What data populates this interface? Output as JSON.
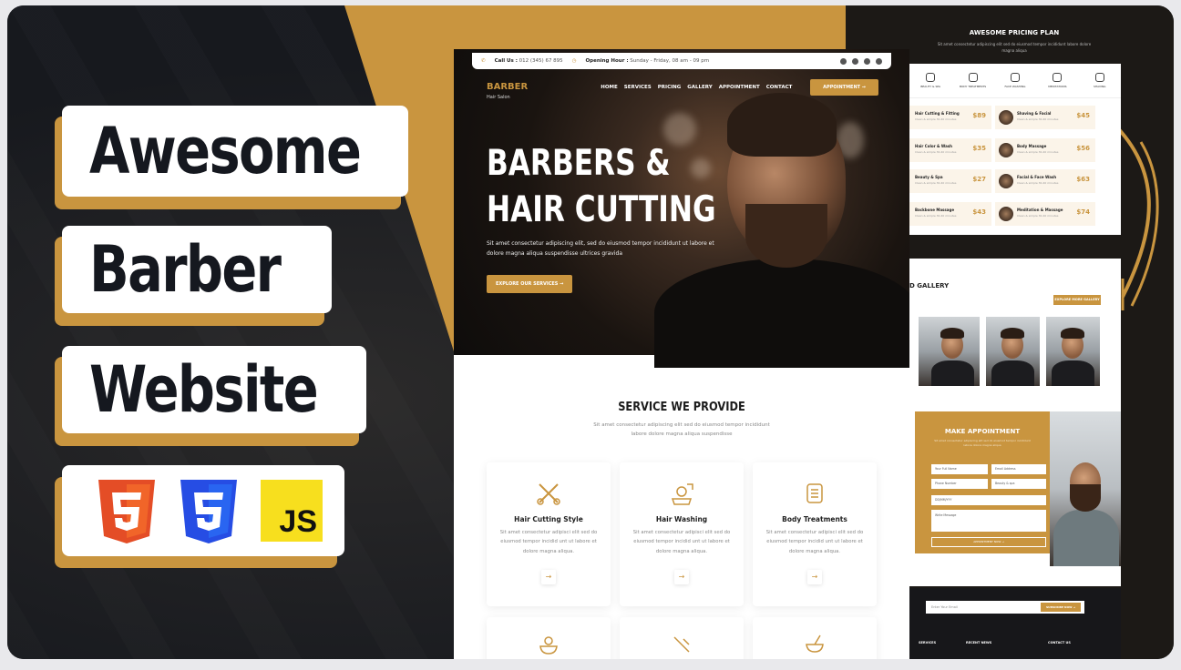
{
  "thumbnail": {
    "title_lines": [
      "Awesome",
      "Barber",
      "Website"
    ],
    "tech_icons": [
      "html5-icon",
      "css3-icon",
      "javascript-icon"
    ],
    "js_label": "JS",
    "colors": {
      "gold": "#c9953f",
      "dark": "#16181d",
      "html": "#e44d26",
      "css": "#264de4",
      "js": "#f7df1e"
    }
  },
  "site": {
    "topbar": {
      "call_label": "Call Us :",
      "call_value": "012 (345) 67 895",
      "hours_label": "Opening Hour :",
      "hours_value": "Sunday - Friday, 08 am - 09 pm"
    },
    "logo": {
      "name": "BARBER",
      "sub": "Hair Salon"
    },
    "menu": [
      "HOME",
      "SERVICES",
      "PRICING",
      "GALLERY",
      "APPOINTMENT",
      "CONTACT"
    ],
    "appointment_button": "APPOINTMENT →",
    "hero": {
      "title_line1": "BARBERS &",
      "title_line2": "HAIR CUTTING",
      "text": "Sit amet consectetur adipiscing elit, sed do eiusmod tempor incididunt ut labore et dolore magna aliqua suspendisse ultrices gravida",
      "button": "EXPLORE OUR SERVICES →"
    },
    "services": {
      "title": "SERVICE WE PROVIDE",
      "subtitle": "Sit amet consectetur adipiscing elit sed do eiusmod tempor incididunt labore dolore magna aliqua suspendisse",
      "cards": [
        {
          "title": "Hair Cutting Style",
          "text": "Sit amet consectetur adipisci elit sed do eiusmod tempor incidid unt ut labore et dolore magna aliqua.",
          "arrow": "→"
        },
        {
          "title": "Hair Washing",
          "text": "Sit amet consectetur adipisci elit sed do eiusmod tempor incidid unt ut labore et dolore magna aliqua.",
          "arrow": "→"
        },
        {
          "title": "Body Treatments",
          "text": "Sit amet consectetur adipisci elit sed do eiusmod tempor incidid unt ut labore et dolore magna aliqua.",
          "arrow": "→"
        }
      ]
    }
  },
  "right_panel": {
    "pricing_title": "AWESOME PRICING PLAN",
    "pricing_sub": "Sit amet consectetur adipiscing elit sed do eiusmod tempor incididunt labore dolore magna aliqua",
    "tabs": [
      "BEAUTY & SPA",
      "BODY TREATMENTS",
      "FACE WASHING",
      "MEDITATIONS",
      "SHAVING"
    ],
    "left_prices": [
      {
        "name": "Hair Cutting & Fitting",
        "desc": "Clean & simple 30-40 minutes",
        "price": "$89"
      },
      {
        "name": "Hair Color & Wash",
        "desc": "Clean & simple 30-40 minutes",
        "price": "$35"
      },
      {
        "name": "Beauty & Spa",
        "desc": "Clean & simple 30-40 minutes",
        "price": "$27"
      },
      {
        "name": "Backbone Massage",
        "desc": "Clean & simple 30-40 minutes",
        "price": "$43"
      }
    ],
    "right_prices": [
      {
        "name": "Shaving & Facial",
        "desc": "Clean & simple 30-40 minutes",
        "price": "$45"
      },
      {
        "name": "Body Massage",
        "desc": "Clean & simple 30-40 minutes",
        "price": "$56"
      },
      {
        "name": "Facial & Face Wash",
        "desc": "Clean & simple 30-40 minutes",
        "price": "$63"
      },
      {
        "name": "Meditation & Massage",
        "desc": "Clean & simple 30-40 minutes",
        "price": "$74"
      }
    ],
    "gallery_title": "D GALLERY",
    "gallery_button": "EXPLORE MORE GALLERY →",
    "appointment": {
      "title": "MAKE APPOINTMENT",
      "sub": "Sit amet consectetur adipiscing elit sed do eiusmod tempor incididunt labore dolore magna aliqua",
      "fields": [
        "Your Full Name",
        "Email Address",
        "Phone Number",
        "Beauty & spa",
        "DD/MM/YYY",
        "Write Message"
      ],
      "button": "APPOINTMENT NOW →"
    },
    "footer": {
      "newsletter_placeholder": "Enter Your Email",
      "subscribe": "SUBSCRIBE NOW →",
      "cols": [
        "SERVICES",
        "RECENT NEWS",
        "CONTACT US"
      ]
    }
  }
}
